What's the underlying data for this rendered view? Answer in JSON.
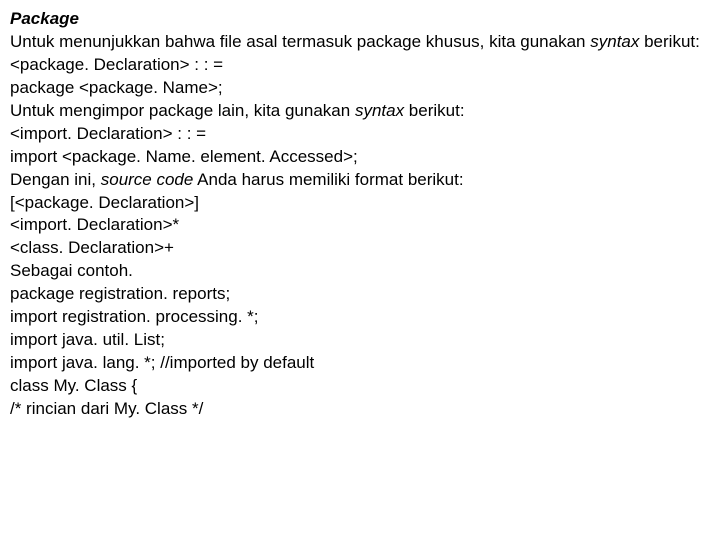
{
  "title": "Package",
  "l1a": "Untuk menunjukkan bahwa file asal termasuk package khusus, kita gunakan ",
  "l1b": "syntax",
  "l1c": " berikut:",
  "l2": "<package. Declaration> : : =",
  "l3": "package <package. Name>;",
  "l4a": "Untuk mengimpor package lain, kita gunakan ",
  "l4b": "syntax",
  "l4c": " berikut:",
  "l5": "<import. Declaration> : : =",
  "l6": "import <package. Name. element. Accessed>;",
  "l7a": "Dengan ini, ",
  "l7b": "source code",
  "l7c": " Anda harus memiliki format berikut:",
  "l8": "[<package. Declaration>]",
  "l9": "<import. Declaration>*",
  "l10": "<class. Declaration>+",
  "l11": "Sebagai contoh.",
  "l12": "package registration. reports;",
  "l13": "import registration. processing. *;",
  "l14": "import java. util. List;",
  "l15": "import java. lang. *; //imported by default",
  "l16": "class My. Class {",
  "l17": "/* rincian dari My. Class */"
}
